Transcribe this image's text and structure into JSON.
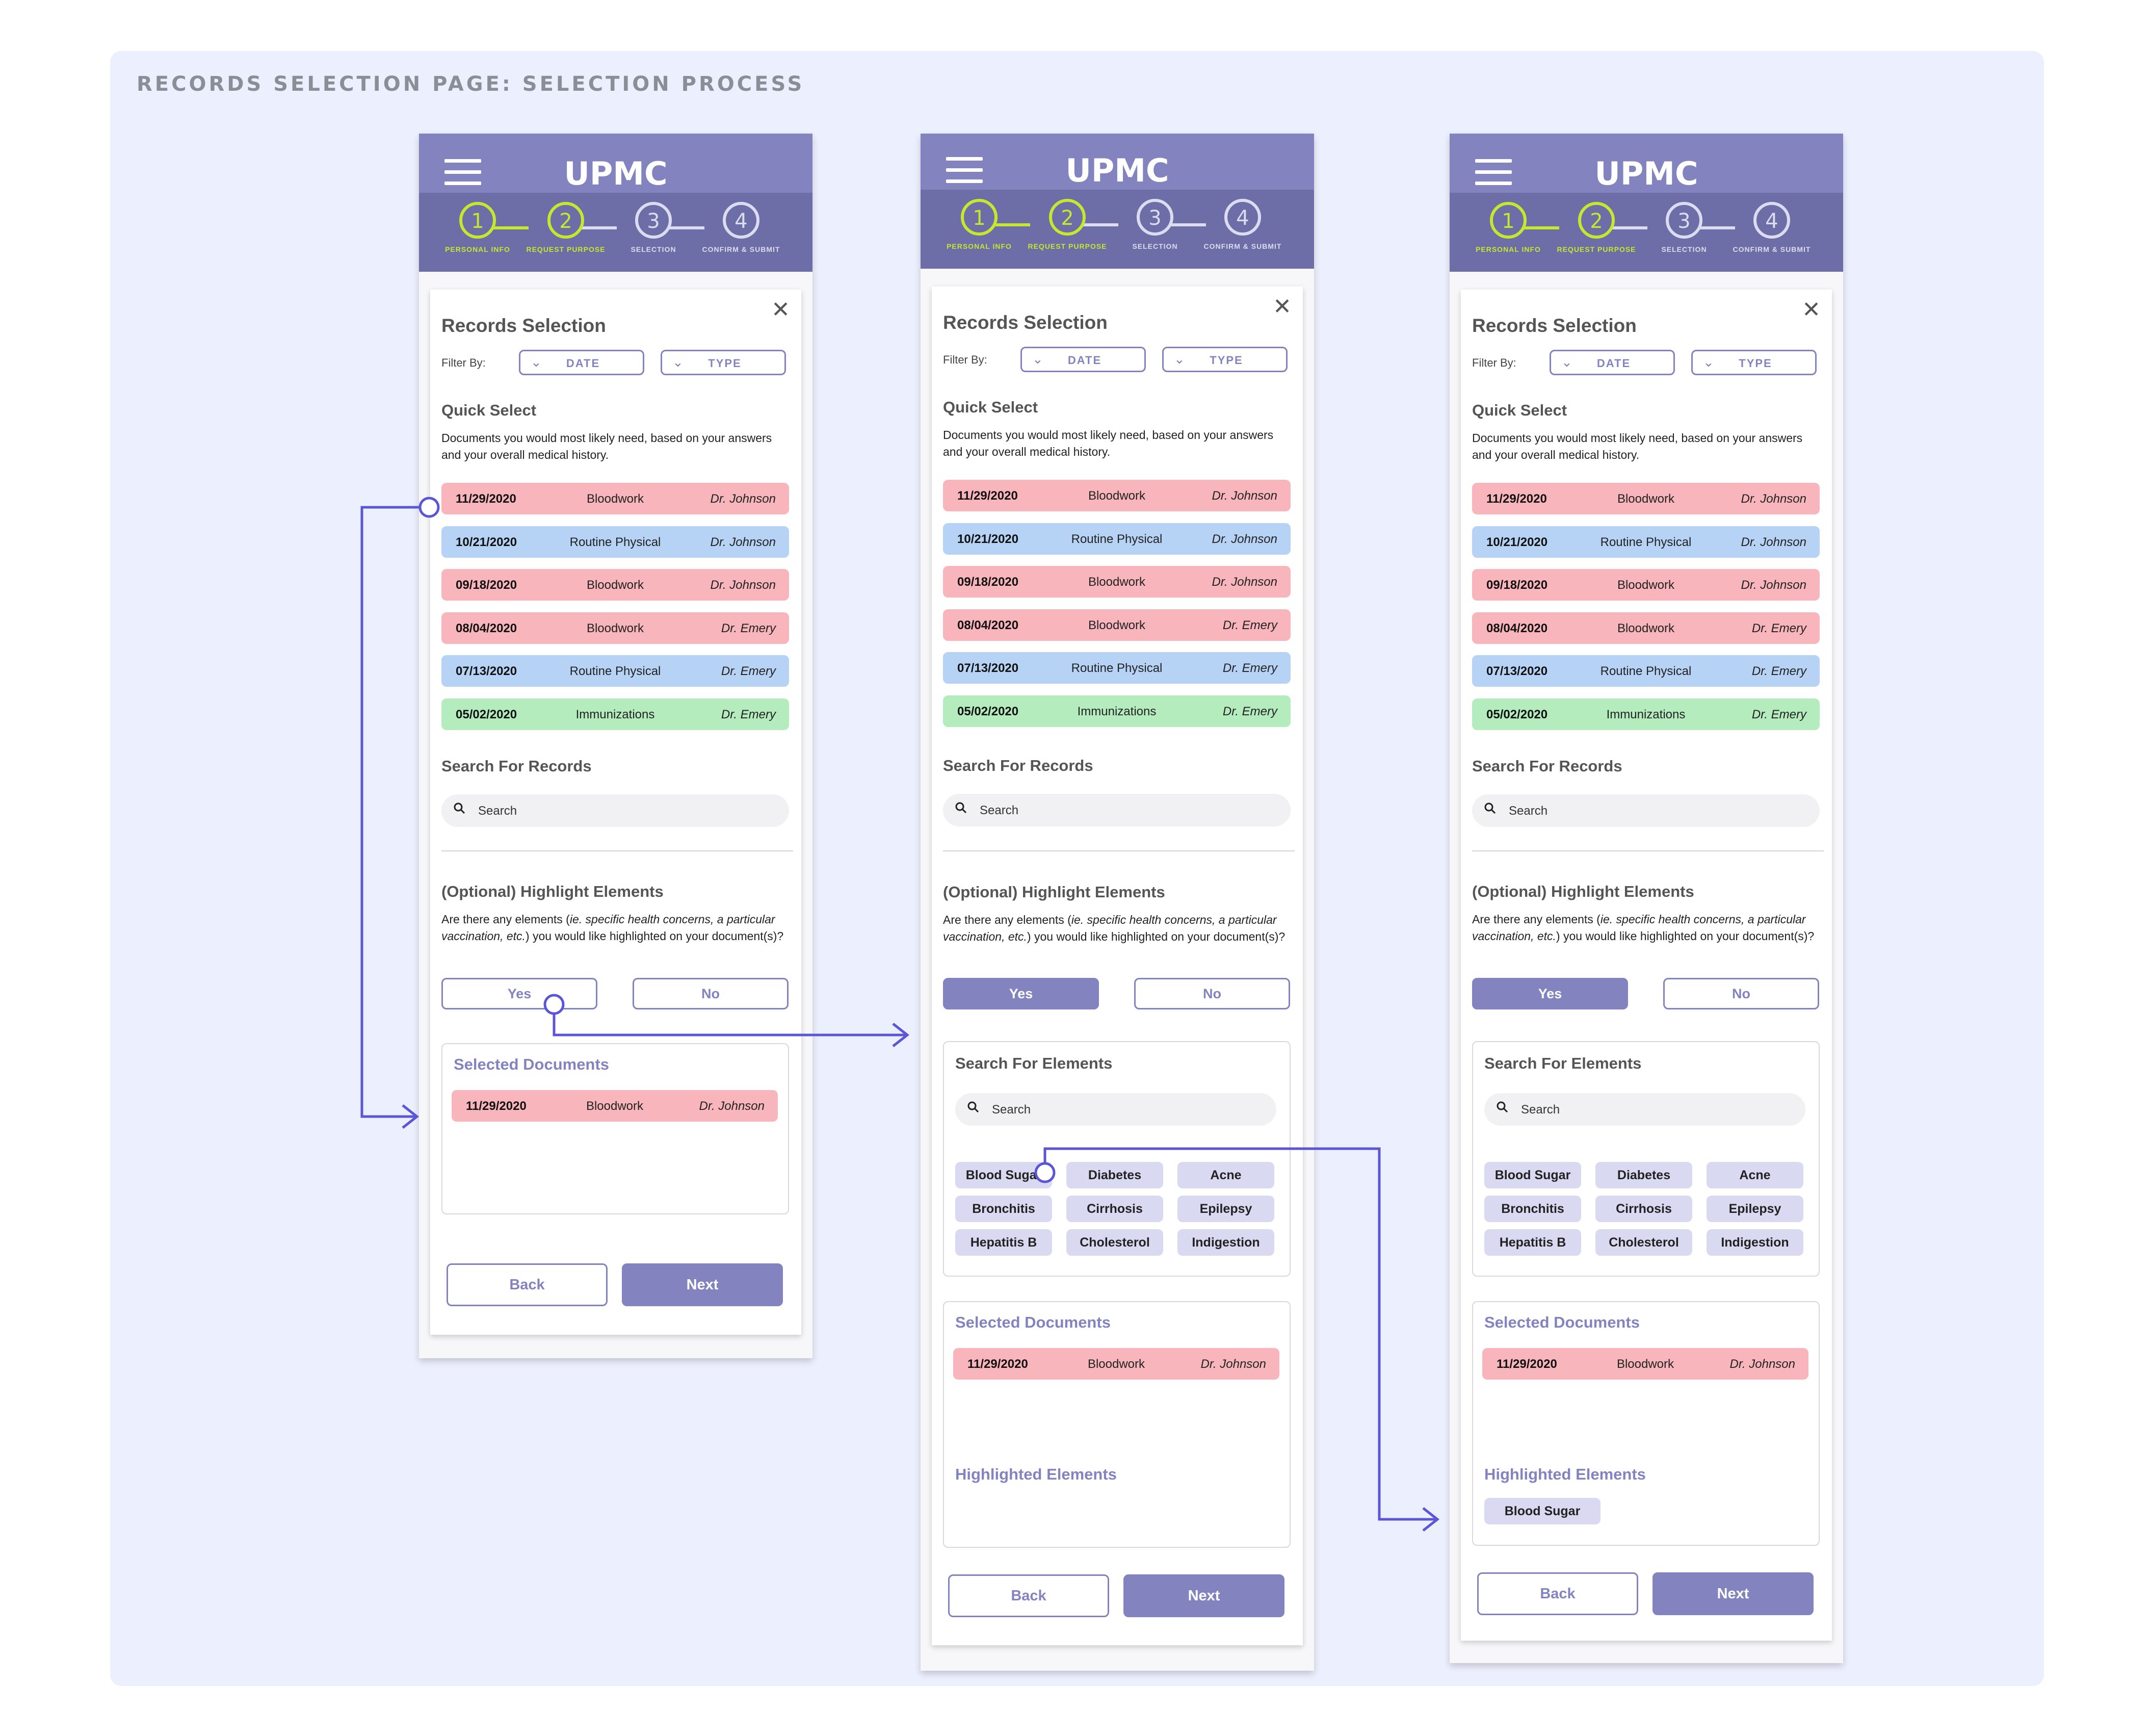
{
  "page_title": "RECORDS SELECTION PAGE: SELECTION PROCESS",
  "app": {
    "logo": "UPMC",
    "steps": [
      {
        "number": "1",
        "label": "PERSONAL INFO",
        "state": "complete"
      },
      {
        "number": "2",
        "label": "REQUEST PURPOSE",
        "state": "complete"
      },
      {
        "number": "3",
        "label": "SELECTION",
        "state": "pending"
      },
      {
        "number": "4",
        "label": "CONFIRM & SUBMIT",
        "state": "pending"
      }
    ]
  },
  "form": {
    "title": "Records Selection",
    "filter_label": "Filter By:",
    "filter_date": "DATE",
    "filter_type": "TYPE",
    "quick_select_title": "Quick Select",
    "quick_select_desc": "Documents you would most likely need, based on your answers and your overall medical history.",
    "records": [
      {
        "date": "11/29/2020",
        "type": "Bloodwork",
        "doctor": "Dr. Johnson",
        "color": "#f8b5bb"
      },
      {
        "date": "10/21/2020",
        "type": "Routine Physical",
        "doctor": "Dr. Johnson",
        "color": "#b6d3f6"
      },
      {
        "date": "09/18/2020",
        "type": "Bloodwork",
        "doctor": "Dr. Johnson",
        "color": "#f8b5bb"
      },
      {
        "date": "08/04/2020",
        "type": "Bloodwork",
        "doctor": "Dr. Emery",
        "color": "#f8b5bb"
      },
      {
        "date": "07/13/2020",
        "type": "Routine Physical",
        "doctor": "Dr. Emery",
        "color": "#b6d3f6"
      },
      {
        "date": "05/02/2020",
        "type": "Immunizations",
        "doctor": "Dr. Emery",
        "color": "#b4ecbe"
      }
    ],
    "search_records_title": "Search For Records",
    "search_placeholder": "Search",
    "highlight_title": "(Optional) Highlight Elements",
    "highlight_question_pre": "Are there any elements (",
    "highlight_question_italic": "ie. specific health concerns, a particular vaccination, etc.",
    "highlight_question_post": ") you would like highlighted on your document(s)?",
    "yes_label": "Yes",
    "no_label": "No",
    "search_elements_title": "Search For Elements",
    "elements": [
      "Blood Sugar",
      "Diabetes",
      "Acne",
      "Bronchitis",
      "Cirrhosis",
      "Epilepsy",
      "Hepatitis B",
      "Cholesterol",
      "Indigestion"
    ],
    "selected_documents_title": "Selected Documents",
    "selected_document": {
      "date": "11/29/2020",
      "type": "Bloodwork",
      "doctor": "Dr. Johnson"
    },
    "highlighted_elements_title": "Highlighted Elements",
    "highlighted_element": "Blood Sugar",
    "back_label": "Back",
    "next_label": "Next"
  },
  "colors": {
    "accent": "#8383c0",
    "header": "#8383c0",
    "stepbar": "#6d6da7",
    "step_active": "#c5e82e",
    "flow_arrow": "#5a56d6"
  }
}
